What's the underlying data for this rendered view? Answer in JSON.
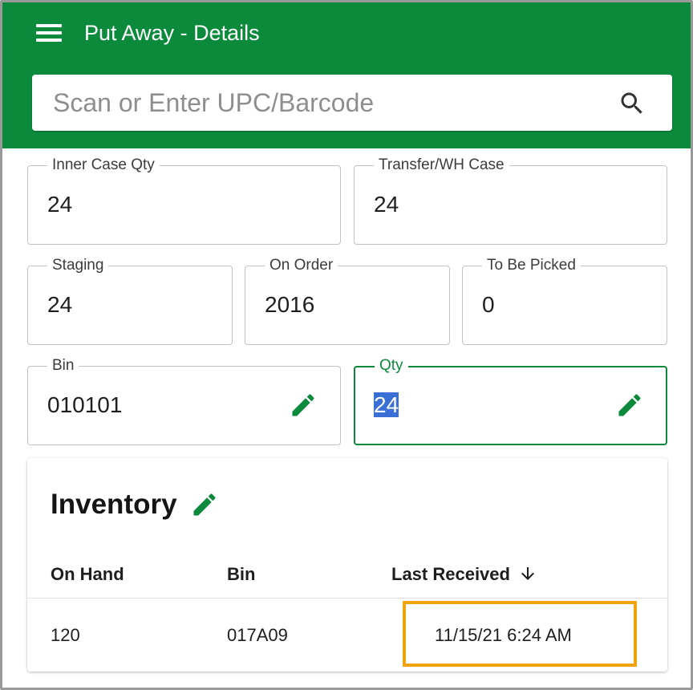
{
  "app": {
    "title": "Put Away - Details"
  },
  "search": {
    "placeholder": "Scan or Enter UPC/Barcode",
    "value": ""
  },
  "fields": {
    "inner_case_qty": {
      "label": "Inner Case Qty",
      "value": "24"
    },
    "transfer_wh_case": {
      "label": "Transfer/WH Case",
      "value": "24"
    },
    "staging": {
      "label": "Staging",
      "value": "24"
    },
    "on_order": {
      "label": "On Order",
      "value": "2016"
    },
    "to_be_picked": {
      "label": "To Be Picked",
      "value": "0"
    },
    "bin": {
      "label": "Bin",
      "value": "010101"
    },
    "qty": {
      "label": "Qty",
      "value": "24"
    }
  },
  "inventory": {
    "title": "Inventory",
    "columns": [
      "On Hand",
      "Bin",
      "Last Received"
    ],
    "sort": {
      "column": "Last Received",
      "direction": "descending"
    },
    "rows": [
      {
        "on_hand": "120",
        "bin": "017A09",
        "last_received": "11/15/21 6:24 AM"
      }
    ]
  },
  "colors": {
    "primary": "#0b8a3c",
    "highlight": "#f0a30a",
    "selection": "#3a6fd6"
  },
  "icons": {
    "menu": "menu-icon",
    "search": "search-icon",
    "edit": "pencil-icon",
    "sort": "arrow-down-icon"
  }
}
